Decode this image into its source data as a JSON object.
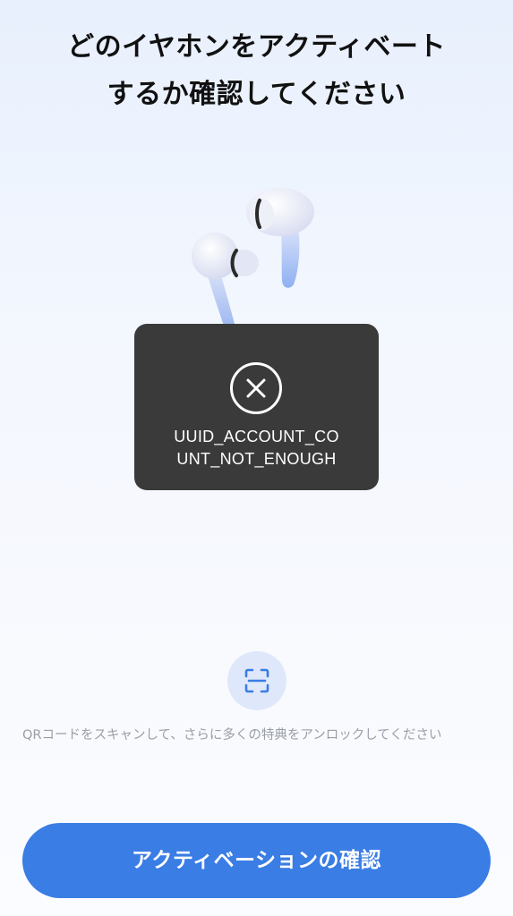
{
  "header": {
    "title_line1": "どのイヤホンをアクティベート",
    "title_line2": "するか確認してください"
  },
  "product": {
    "image": "earbuds-illustration"
  },
  "toast": {
    "icon": "close-circle-icon",
    "message_line1": "UUID_ACCOUNT_CO",
    "message_line2": "UNT_NOT_ENOUGH"
  },
  "scan": {
    "icon": "qr-scan-icon",
    "description": "QRコードをスキャンして、さらに多くの特典をアンロックしてください"
  },
  "actions": {
    "confirm_label": "アクティベーションの確認"
  },
  "colors": {
    "accent": "#3a7de4",
    "toast_bg": "#3a3a3a",
    "scan_bg": "#dfe8fb"
  }
}
